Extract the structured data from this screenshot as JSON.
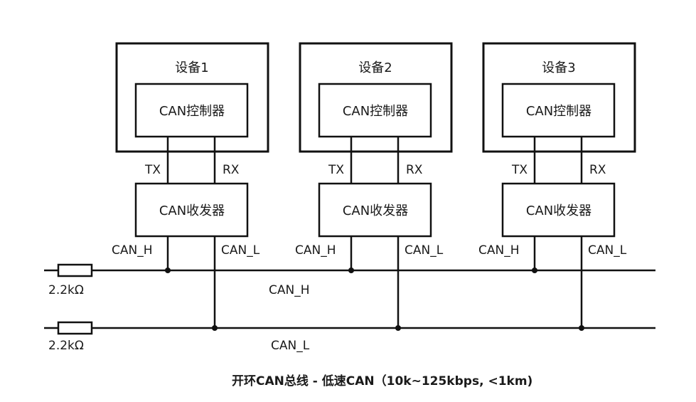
{
  "devices": [
    {
      "name": "设备1",
      "controller": "CAN控制器",
      "transceiver": "CAN收发器",
      "tx": "TX",
      "rx": "RX",
      "can_h": "CAN_H",
      "can_l": "CAN_L"
    },
    {
      "name": "设备2",
      "controller": "CAN控制器",
      "transceiver": "CAN收发器",
      "tx": "TX",
      "rx": "RX",
      "can_h": "CAN_H",
      "can_l": "CAN_L"
    },
    {
      "name": "设备3",
      "controller": "CAN控制器",
      "transceiver": "CAN收发器",
      "tx": "TX",
      "rx": "RX",
      "can_h": "CAN_H",
      "can_l": "CAN_L"
    }
  ],
  "bus": {
    "h_label": "CAN_H",
    "l_label": "CAN_L",
    "resistors": [
      "2.2kΩ",
      "2.2kΩ"
    ]
  },
  "caption": "开环CAN总线 - 低速CAN（10k~125kbps, <1km)"
}
